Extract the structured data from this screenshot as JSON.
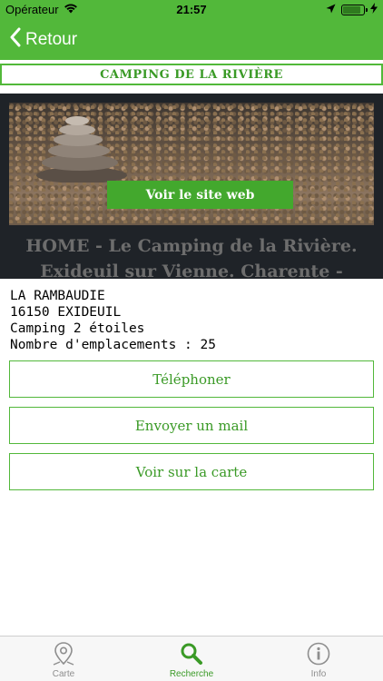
{
  "status_bar": {
    "carrier": "Opérateur",
    "time": "21:57",
    "battery_level": 0.85
  },
  "nav": {
    "back_label": "Retour"
  },
  "title": "CAMPING DE LA RIVIÈRE",
  "web_preview": {
    "button_label": "Voir le site web",
    "heading_line1": "HOME - Le Camping de la Rivière.",
    "heading_line2": "Exideuil sur Vienne. Charente -"
  },
  "info": {
    "address_line1": "LA RAMBAUDIE",
    "address_line2": "16150 EXIDEUIL",
    "rating": "Camping 2 étoiles",
    "spots": "Nombre d'emplacements : 25"
  },
  "actions": {
    "phone": "Téléphoner",
    "mail": "Envoyer un mail",
    "map": "Voir sur la carte"
  },
  "tabs": [
    {
      "label": "Carte",
      "icon": "map-pin-icon",
      "active": false
    },
    {
      "label": "Recherche",
      "icon": "search-icon",
      "active": true
    },
    {
      "label": "Info",
      "icon": "info-icon",
      "active": false
    }
  ],
  "colors": {
    "accent": "#52b83a",
    "accent_text": "#3a9a26",
    "inactive_tab": "#8e8e8e"
  }
}
